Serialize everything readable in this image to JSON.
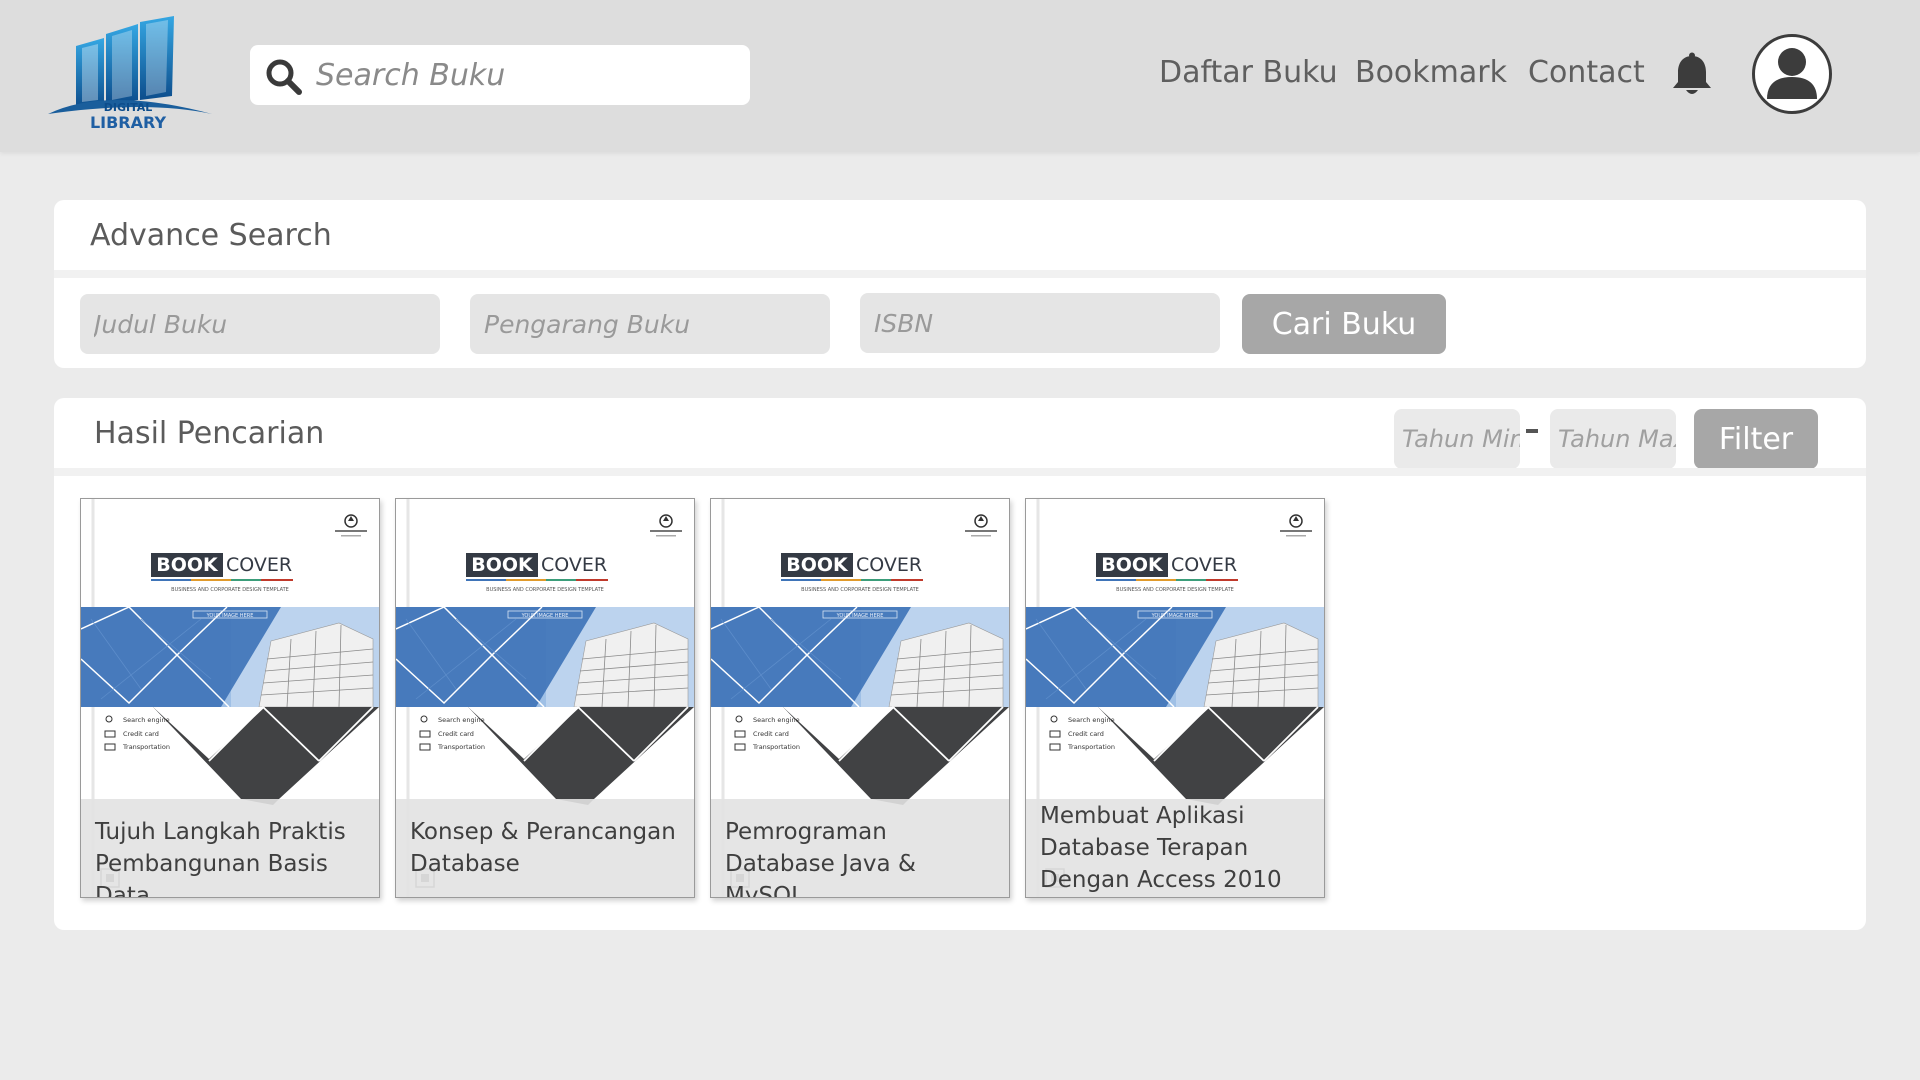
{
  "header": {
    "logo": {
      "line1": "DIGITAL",
      "line2": "LIBRARY"
    },
    "search": {
      "placeholder": "Search Buku"
    },
    "nav": [
      {
        "label": "Daftar Buku"
      },
      {
        "label": "Bookmark"
      },
      {
        "label": "Contact"
      }
    ]
  },
  "advance_search": {
    "title": "Advance Search",
    "fields": {
      "judul": {
        "placeholder": "Judul Buku"
      },
      "pengarang": {
        "placeholder": "Pengarang Buku"
      },
      "isbn": {
        "placeholder": "ISBN"
      }
    },
    "submit_label": "Cari Buku"
  },
  "results": {
    "title": "Hasil Pencarian",
    "filter": {
      "min_placeholder": "Tahun Min",
      "max_placeholder": "Tahun Max",
      "button_label": "Filter"
    },
    "cover": {
      "word_bold": "BOOK",
      "word_light": "COVER",
      "tagline": "BUSINESS AND CORPORATE DESIGN TEMPLATE",
      "image_label": "YOUR IMAGE HERE",
      "list": [
        "Search engine",
        "Credit card",
        "Transportation"
      ]
    },
    "books": [
      {
        "title": "Tujuh Langkah Praktis Pembangunan Basis Data"
      },
      {
        "title": "Konsep & Perancangan Database"
      },
      {
        "title": "Pemrograman Database Java & MySQL"
      },
      {
        "title": "Membuat Aplikasi Database Terapan Dengan Access 2010"
      }
    ]
  },
  "colors": {
    "header_bg": "#dddddd",
    "page_bg": "#ebebeb",
    "button_bg": "#a7a7a7",
    "cover_blue": "#3f74b8",
    "cover_dark": "#414244",
    "logo_blue": "#1f6fae"
  }
}
